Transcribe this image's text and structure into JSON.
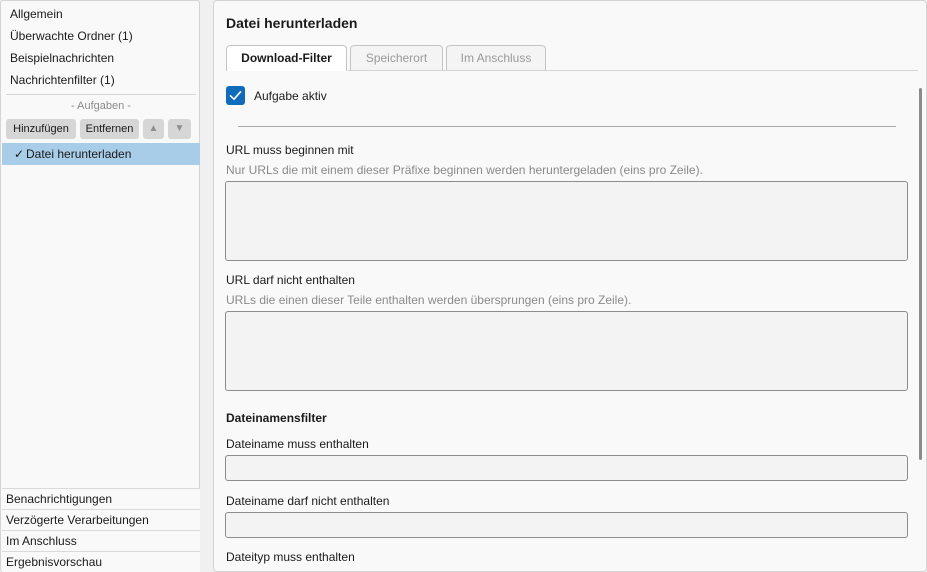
{
  "sidebar": {
    "items": [
      {
        "label": "Allgemein"
      },
      {
        "label": "Überwachte Ordner (1)"
      },
      {
        "label": "Beispielnachrichten"
      },
      {
        "label": "Nachrichtenfilter (1)"
      }
    ],
    "tasks_section_title": "- Aufgaben -",
    "add_label": "Hinzufügen",
    "remove_label": "Entfernen",
    "move_up_glyph": "▲",
    "move_down_glyph": "▼",
    "tasks": [
      {
        "check": "✓",
        "label": "Datei herunterladen",
        "selected": true
      }
    ],
    "bottom_items": [
      {
        "label": "Benachrichtigungen"
      },
      {
        "label": "Verzögerte Verarbeitungen"
      },
      {
        "label": "Im Anschluss"
      },
      {
        "label": "Ergebnisvorschau"
      }
    ]
  },
  "main": {
    "title": "Datei herunterladen",
    "tabs": [
      {
        "label": "Download-Filter",
        "active": true
      },
      {
        "label": "Speicherort",
        "active": false
      },
      {
        "label": "Im Anschluss",
        "active": false
      }
    ],
    "active_checkbox": {
      "label": "Aufgabe aktiv",
      "checked": true
    },
    "url_must_start": {
      "label": "URL muss beginnen mit",
      "hint": "Nur URLs die mit einem dieser Präfixe beginnen werden heruntergeladen (eins pro Zeile).",
      "value": ""
    },
    "url_must_not_contain": {
      "label": "URL darf nicht enthalten",
      "hint": "URLs die einen dieser Teile enthalten werden übersprungen (eins pro Zeile).",
      "value": ""
    },
    "filename_filter": {
      "title": "Dateinamensfilter",
      "must_contain": {
        "label": "Dateiname muss enthalten",
        "value": ""
      },
      "must_not_contain": {
        "label": "Dateiname darf nicht enthalten",
        "value": ""
      },
      "filetype_must_contain": {
        "label": "Dateityp muss enthalten"
      }
    }
  },
  "colors": {
    "accent": "#0f6cbd",
    "selection": "#a8cde8",
    "hint_text": "#8a8a8a"
  }
}
